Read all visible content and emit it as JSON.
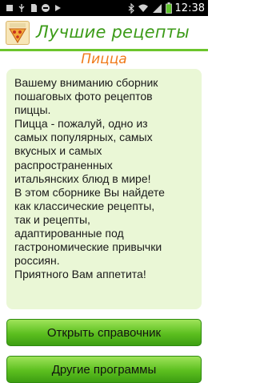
{
  "status_bar": {
    "time": "12:38",
    "icons": [
      "notification-icon",
      "usb-icon",
      "sd-card-icon",
      "chat-icon",
      "play-store-icon",
      "bluetooth-icon",
      "wifi-icon",
      "signal-icon",
      "battery-icon"
    ]
  },
  "app": {
    "title": "Лучшие рецепты"
  },
  "section": {
    "title": "Пицца"
  },
  "card": {
    "text": "Вашему вниманию сборник\nпошаговых фото рецептов\nпиццы.\nПицца - пожалуй, одно из\nсамых популярных, самых\nвкусных и самых\nраспространенных\nитальянских блюд в мире!\nВ этом сборнике Вы найдете\nкак классические рецепты,\nтак и рецепты,\nадаптированные под\nгастрономические привычки\nроссиян.\nПриятного Вам аппетита!"
  },
  "buttons": {
    "open_label": "Открыть справочник",
    "other_label": "Другие программы"
  },
  "colors": {
    "accent_green": "#3c9b18",
    "title_orange": "#f07a1a",
    "card_bg": "#eaf7d6",
    "button_green": "#5cbf1f"
  }
}
